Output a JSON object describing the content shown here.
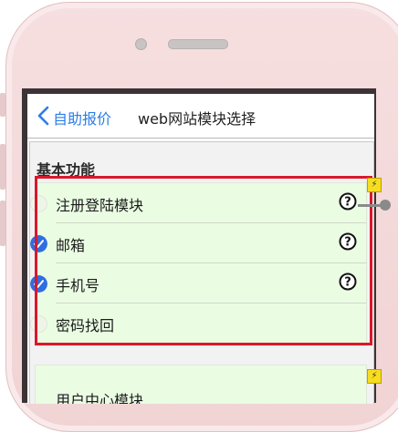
{
  "navbar": {
    "back_label": "自助报价",
    "title": "web网站模块选择"
  },
  "section": {
    "title": "基本功能"
  },
  "module_group": {
    "items": [
      {
        "label": "注册登陆模块",
        "selected": false,
        "has_help": true
      },
      {
        "label": "邮箱",
        "selected": true,
        "has_help": true
      },
      {
        "label": "手机号",
        "selected": true,
        "has_help": true
      },
      {
        "label": "密码找回",
        "selected": false,
        "has_help": false
      }
    ]
  },
  "next_group": {
    "title": "用户中心模块"
  },
  "colors": {
    "accent": "#2b7de9",
    "checked": "#2f6de1",
    "list_bg": "#eafde3",
    "highlight": "#d9182a",
    "phone_body": "#f1d3d4"
  },
  "icons": {
    "back": "chevron-left-icon",
    "help": "question-circle-icon",
    "bolt": "lightning-icon"
  }
}
